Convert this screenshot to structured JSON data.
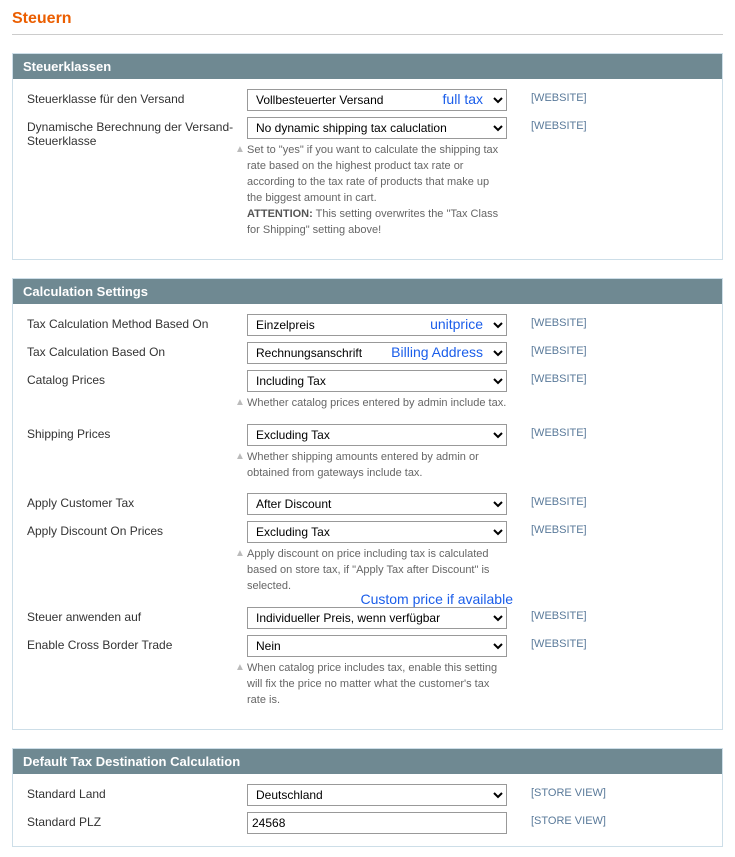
{
  "page": {
    "title": "Steuern"
  },
  "sections": {
    "tax_classes": {
      "title": "Steuerklassen",
      "shipping_class": {
        "label": "Steuerklasse für den Versand",
        "value": "Vollbesteuerter Versand",
        "scope": "[WEBSITE]",
        "annotation": "full tax"
      },
      "dynamic": {
        "label": "Dynamische Berechnung der Versand-Steuerklasse",
        "value": "No dynamic shipping tax caluclation",
        "scope": "[WEBSITE]",
        "help_pre": "Set to \"yes\" if you want to calculate the shipping tax rate based on the highest product tax rate or according to the tax rate of products that make up the biggest amount in cart.",
        "help_att_label": "ATTENTION:",
        "help_att": " This setting overwrites the \"Tax Class for Shipping\" setting above!"
      }
    },
    "calc": {
      "title": "Calculation Settings",
      "method": {
        "label": "Tax Calculation Method Based On",
        "value": "Einzelpreis",
        "scope": "[WEBSITE]",
        "annotation": "unitprice"
      },
      "based_on": {
        "label": "Tax Calculation Based On",
        "value": "Rechnungsanschrift",
        "scope": "[WEBSITE]",
        "annotation": "Billing Address"
      },
      "catalog_prices": {
        "label": "Catalog Prices",
        "value": "Including Tax",
        "scope": "[WEBSITE]",
        "help": "Whether catalog prices entered by admin include tax."
      },
      "shipping_prices": {
        "label": "Shipping Prices",
        "value": "Excluding Tax",
        "scope": "[WEBSITE]",
        "help": "Whether shipping amounts entered by admin or obtained from gateways include tax."
      },
      "apply_customer_tax": {
        "label": "Apply Customer Tax",
        "value": "After Discount",
        "scope": "[WEBSITE]"
      },
      "apply_discount": {
        "label": "Apply Discount On Prices",
        "value": "Excluding Tax",
        "scope": "[WEBSITE]",
        "help": "Apply discount on price including tax is calculated based on store tax, if \"Apply Tax after Discount\" is selected."
      },
      "apply_tax_on": {
        "label": "Steuer anwenden auf",
        "value": "Individueller Preis, wenn verfügbar",
        "scope": "[WEBSITE]",
        "annotation": "Custom price if available"
      },
      "cross_border": {
        "label": "Enable Cross Border Trade",
        "value": "Nein",
        "scope": "[WEBSITE]",
        "help": "When catalog price includes tax, enable this setting will fix the price no matter what the customer's tax rate is."
      }
    },
    "default_dest": {
      "title": "Default Tax Destination Calculation",
      "country": {
        "label": "Standard Land",
        "value": "Deutschland",
        "scope": "[STORE VIEW]"
      },
      "plz": {
        "label": "Standard PLZ",
        "value": "24568",
        "scope": "[STORE VIEW]"
      }
    }
  }
}
